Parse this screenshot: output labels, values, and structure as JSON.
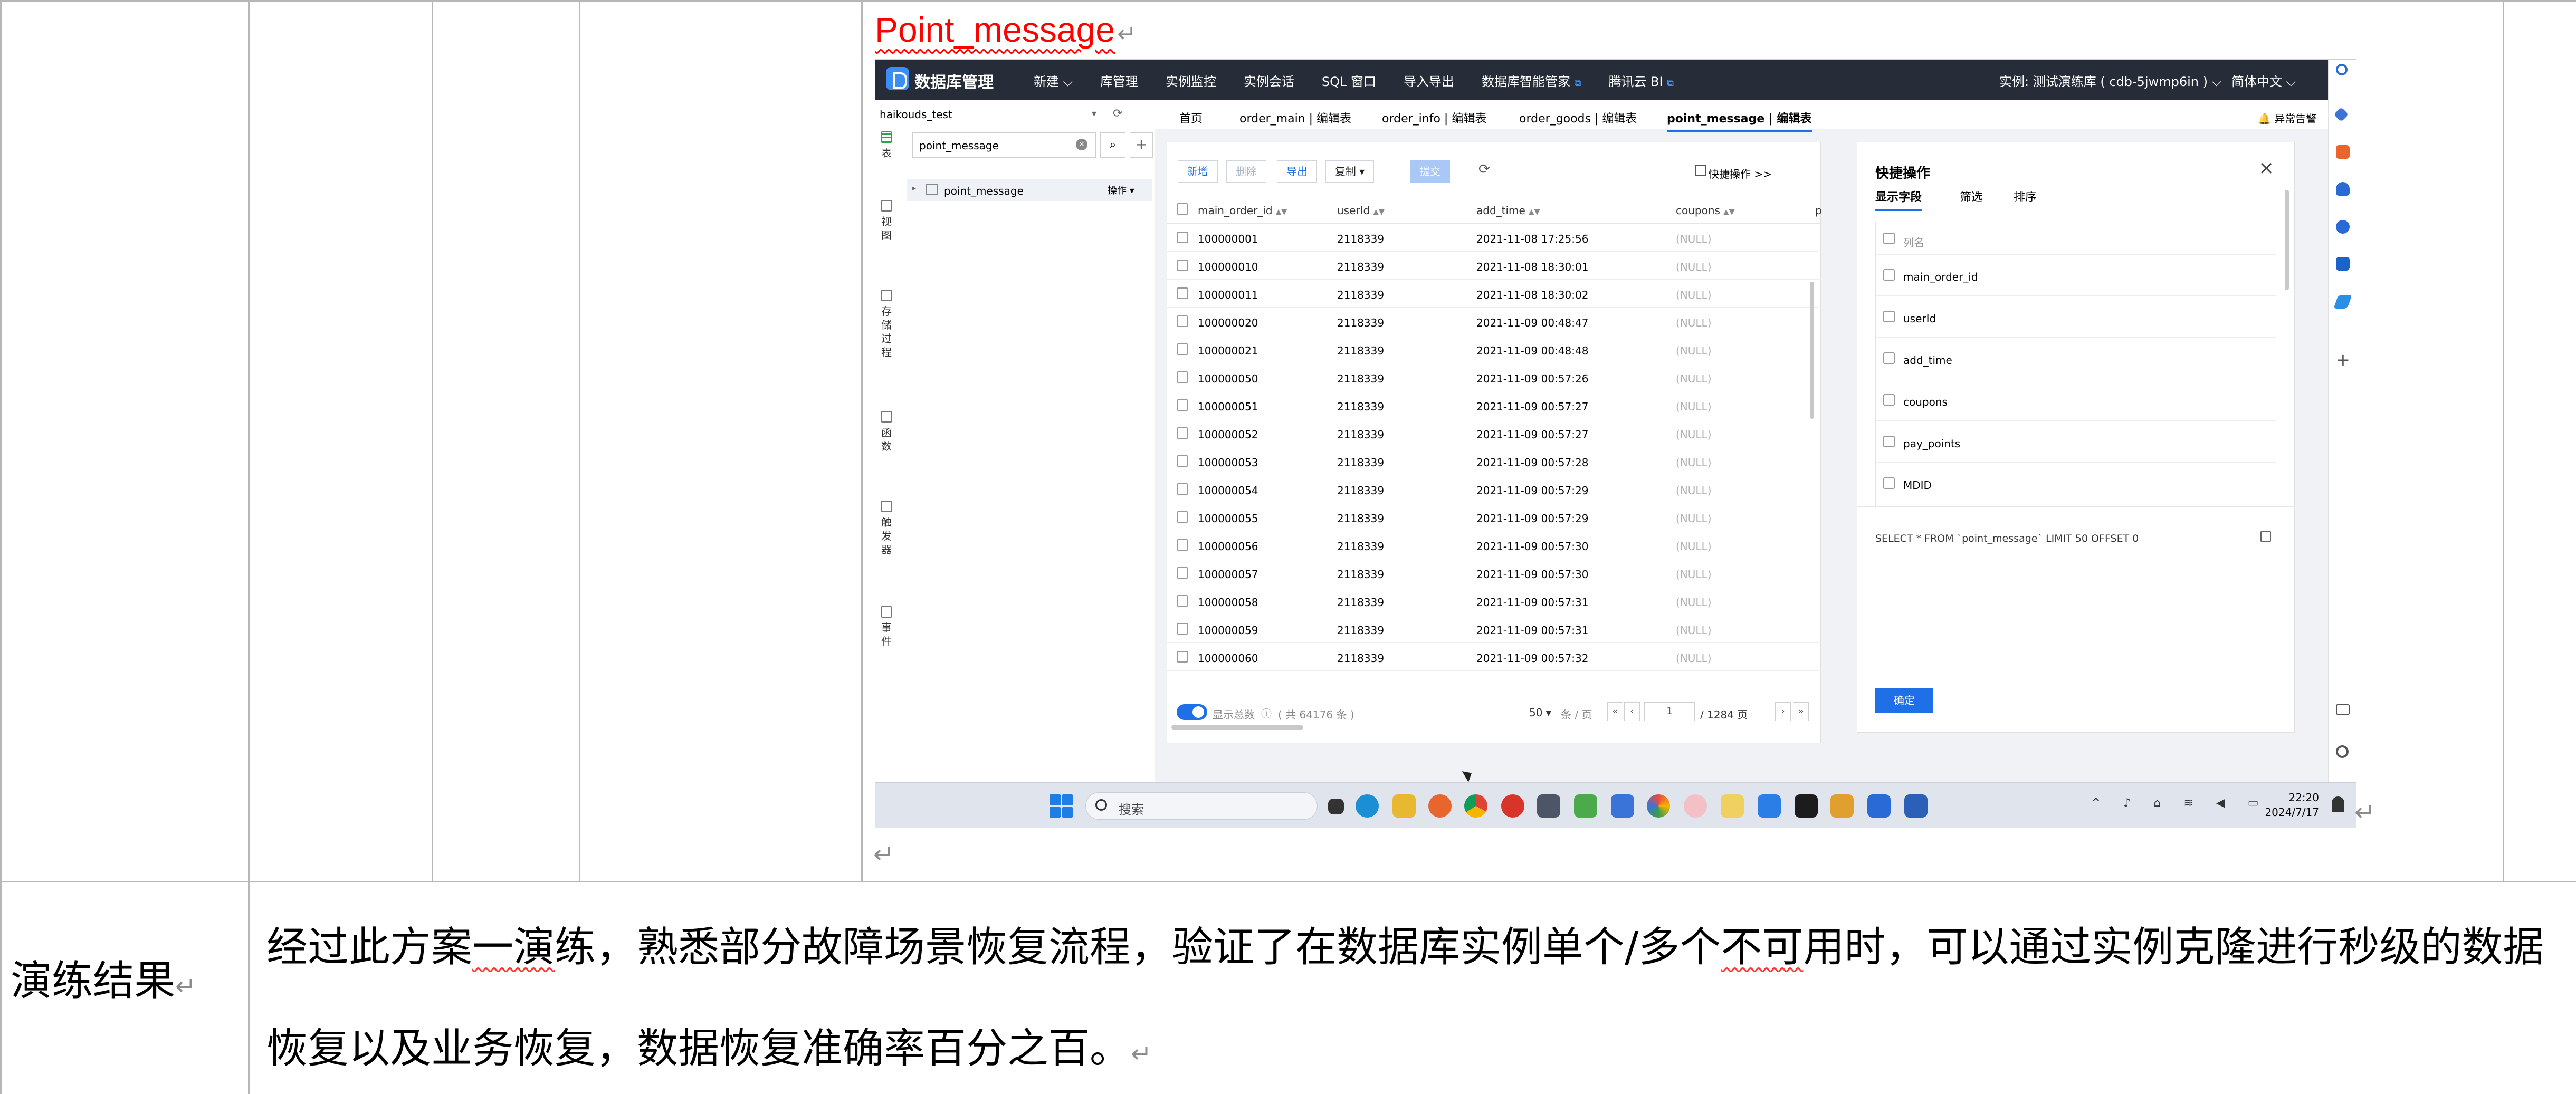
{
  "doc": {
    "cell_title": "Point_message",
    "para_mark": "↵",
    "result_label": "演练结果",
    "result_text_before": "经过此方案",
    "result_text_wavy1": "一演",
    "result_text_mid": "练，熟悉部分故障场景恢复流程，验证了在数据库实例单个/多个",
    "result_text_wavy2": "不可",
    "result_text_after": "用时，可以通过实例克隆进行秒级的数据恢复以及业务恢复，数据恢复准确率百分之百。"
  },
  "app": {
    "brand": "数据库管理",
    "nav": [
      "新建 ⌵",
      "库管理",
      "实例监控",
      "实例会话",
      "SQL 窗口",
      "导入导出",
      "数据库智能管家",
      "腾讯云 BI"
    ],
    "instance": "实例: 测试演练库 ( cdb-5jwmp6in ) ⌵",
    "language": "简体中文 ⌵",
    "database": "haikouds_test",
    "search_value": "point_message",
    "side_tabs": [
      "表",
      "视图",
      "存储过程",
      "函数",
      "触发器",
      "事件"
    ],
    "tree_table": "point_message",
    "tree_op": "操作 ▾",
    "tabs": [
      "首页",
      "order_main | 编辑表",
      "order_info | 编辑表",
      "order_goods | 编辑表",
      "point_message | 编辑表"
    ],
    "alert": "异常告警",
    "toolbar": {
      "add": "新增",
      "delete": "删除",
      "export": "导出",
      "copy": "复制 ▾",
      "submit": "提交",
      "quick": "快捷操作 >>"
    },
    "columns": [
      "main_order_id",
      "userId",
      "add_time",
      "coupons",
      "p"
    ],
    "rows": [
      [
        "100000001",
        "2118339",
        "2021-11-08 17:25:56",
        "(NULL)"
      ],
      [
        "100000010",
        "2118339",
        "2021-11-08 18:30:01",
        "(NULL)"
      ],
      [
        "100000011",
        "2118339",
        "2021-11-08 18:30:02",
        "(NULL)"
      ],
      [
        "100000020",
        "2118339",
        "2021-11-09 00:48:47",
        "(NULL)"
      ],
      [
        "100000021",
        "2118339",
        "2021-11-09 00:48:48",
        "(NULL)"
      ],
      [
        "100000050",
        "2118339",
        "2021-11-09 00:57:26",
        "(NULL)"
      ],
      [
        "100000051",
        "2118339",
        "2021-11-09 00:57:27",
        "(NULL)"
      ],
      [
        "100000052",
        "2118339",
        "2021-11-09 00:57:27",
        "(NULL)"
      ],
      [
        "100000053",
        "2118339",
        "2021-11-09 00:57:28",
        "(NULL)"
      ],
      [
        "100000054",
        "2118339",
        "2021-11-09 00:57:29",
        "(NULL)"
      ],
      [
        "100000055",
        "2118339",
        "2021-11-09 00:57:29",
        "(NULL)"
      ],
      [
        "100000056",
        "2118339",
        "2021-11-09 00:57:30",
        "(NULL)"
      ],
      [
        "100000057",
        "2118339",
        "2021-11-09 00:57:30",
        "(NULL)"
      ],
      [
        "100000058",
        "2118339",
        "2021-11-09 00:57:31",
        "(NULL)"
      ],
      [
        "100000059",
        "2118339",
        "2021-11-09 00:57:31",
        "(NULL)"
      ],
      [
        "100000060",
        "2118339",
        "2021-11-09 00:57:32",
        "(NULL)"
      ]
    ],
    "footer": {
      "show_total": "显示总数",
      "total": "( 共 64176 条 )",
      "page_size": "50 ▾",
      "per_page": "条 / 页",
      "page": "1",
      "total_pages": "/ 1284 页"
    },
    "panel": {
      "title": "快捷操作",
      "tabs": [
        "显示字段",
        "筛选",
        "排序"
      ],
      "header": "列名",
      "fields": [
        "main_order_id",
        "userId",
        "add_time",
        "coupons",
        "pay_points",
        "MDID"
      ],
      "sql": "SELECT * FROM `point_message` LIMIT 50 OFFSET 0",
      "confirm": "确定"
    },
    "taskbar": {
      "search": "搜索",
      "time": "22:20",
      "date": "2024/7/17"
    },
    "colors": {
      "accent": "#1f6fe6",
      "topbar": "#262d39",
      "title_red": "#ff0000"
    }
  }
}
